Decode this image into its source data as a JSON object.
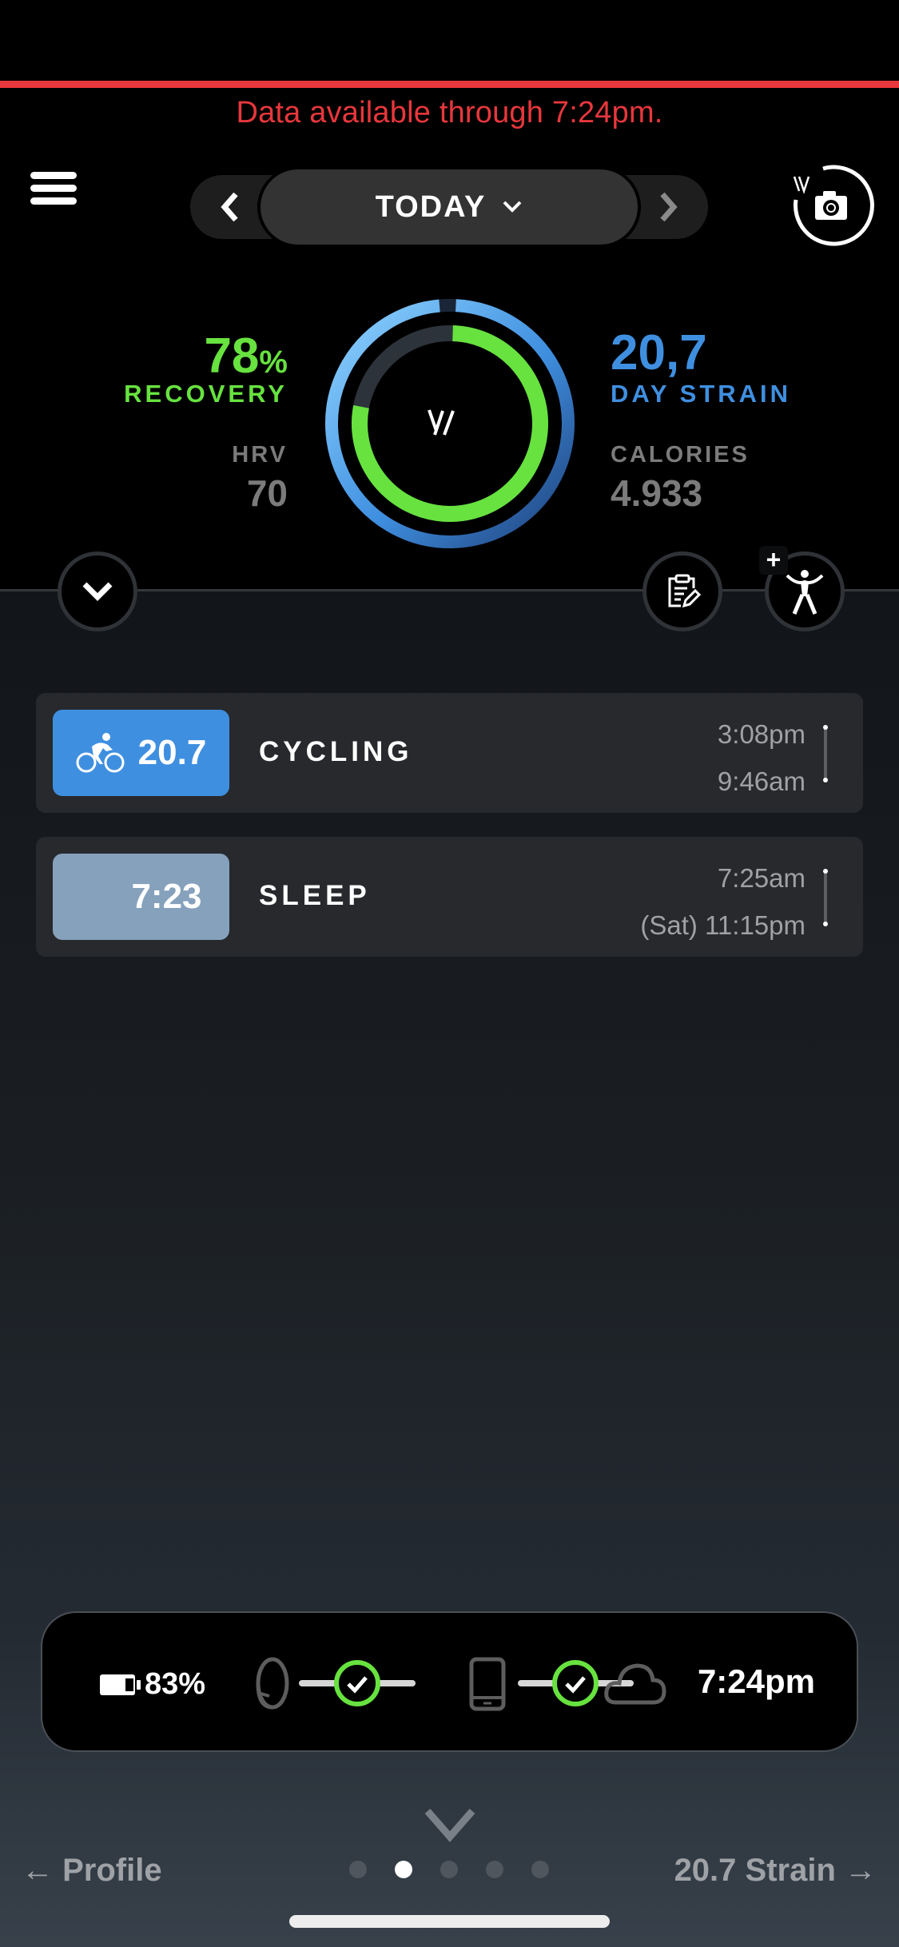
{
  "banner": {
    "text": "Data available through 7:24pm.",
    "color": "#e8373c"
  },
  "header": {
    "menu_icon": "hamburger-menu-icon",
    "date_label": "TODAY",
    "prev_icon": "chevron-left-icon",
    "next_icon": "chevron-right-icon",
    "dropdown_icon": "chevron-down-icon",
    "camera_icon": "whoop-camera-icon"
  },
  "summary": {
    "recovery": {
      "value": "78",
      "unit": "%",
      "label": "RECOVERY",
      "percent": 78,
      "color": "#67e23f"
    },
    "hrv": {
      "label": "HRV",
      "value": "70"
    },
    "strain": {
      "value": "20,7",
      "label": "DAY STRAIN",
      "fraction_of_max": 0.986,
      "max": 21,
      "color": "#3f8fe0"
    },
    "calories": {
      "label": "CALORIES",
      "value": "4.933"
    },
    "center_logo": "W"
  },
  "actions": {
    "expand_icon": "chevron-down-icon",
    "journal_icon": "clipboard-edit-icon",
    "activity_icon": "person-activity-icon",
    "add_badge": "+"
  },
  "activities": [
    {
      "type": "cycling",
      "icon": "bicycle-icon",
      "value": "20.7",
      "name": "CYCLING",
      "end_time": "3:08pm",
      "start_time": "9:46am",
      "color": "#3f8fe0"
    },
    {
      "type": "sleep",
      "icon": "moon-icon",
      "value": "7:23",
      "name": "SLEEP",
      "end_time": "7:25am",
      "start_time": "(Sat) 11:15pm",
      "color": "#86a1bc"
    }
  ],
  "sync": {
    "battery_percent": "83%",
    "battery_level": 0.83,
    "strap_icon": "whoop-strap-icon",
    "phone_icon": "phone-icon",
    "cloud_icon": "cloud-icon",
    "check_icon": "check-circle-icon",
    "last_sync_time": "7:24pm",
    "status_color": "#67e23f"
  },
  "footer": {
    "prev_label": "← Profile",
    "next_label": "20.7 Strain →",
    "page_count": 5,
    "active_page": 2
  }
}
